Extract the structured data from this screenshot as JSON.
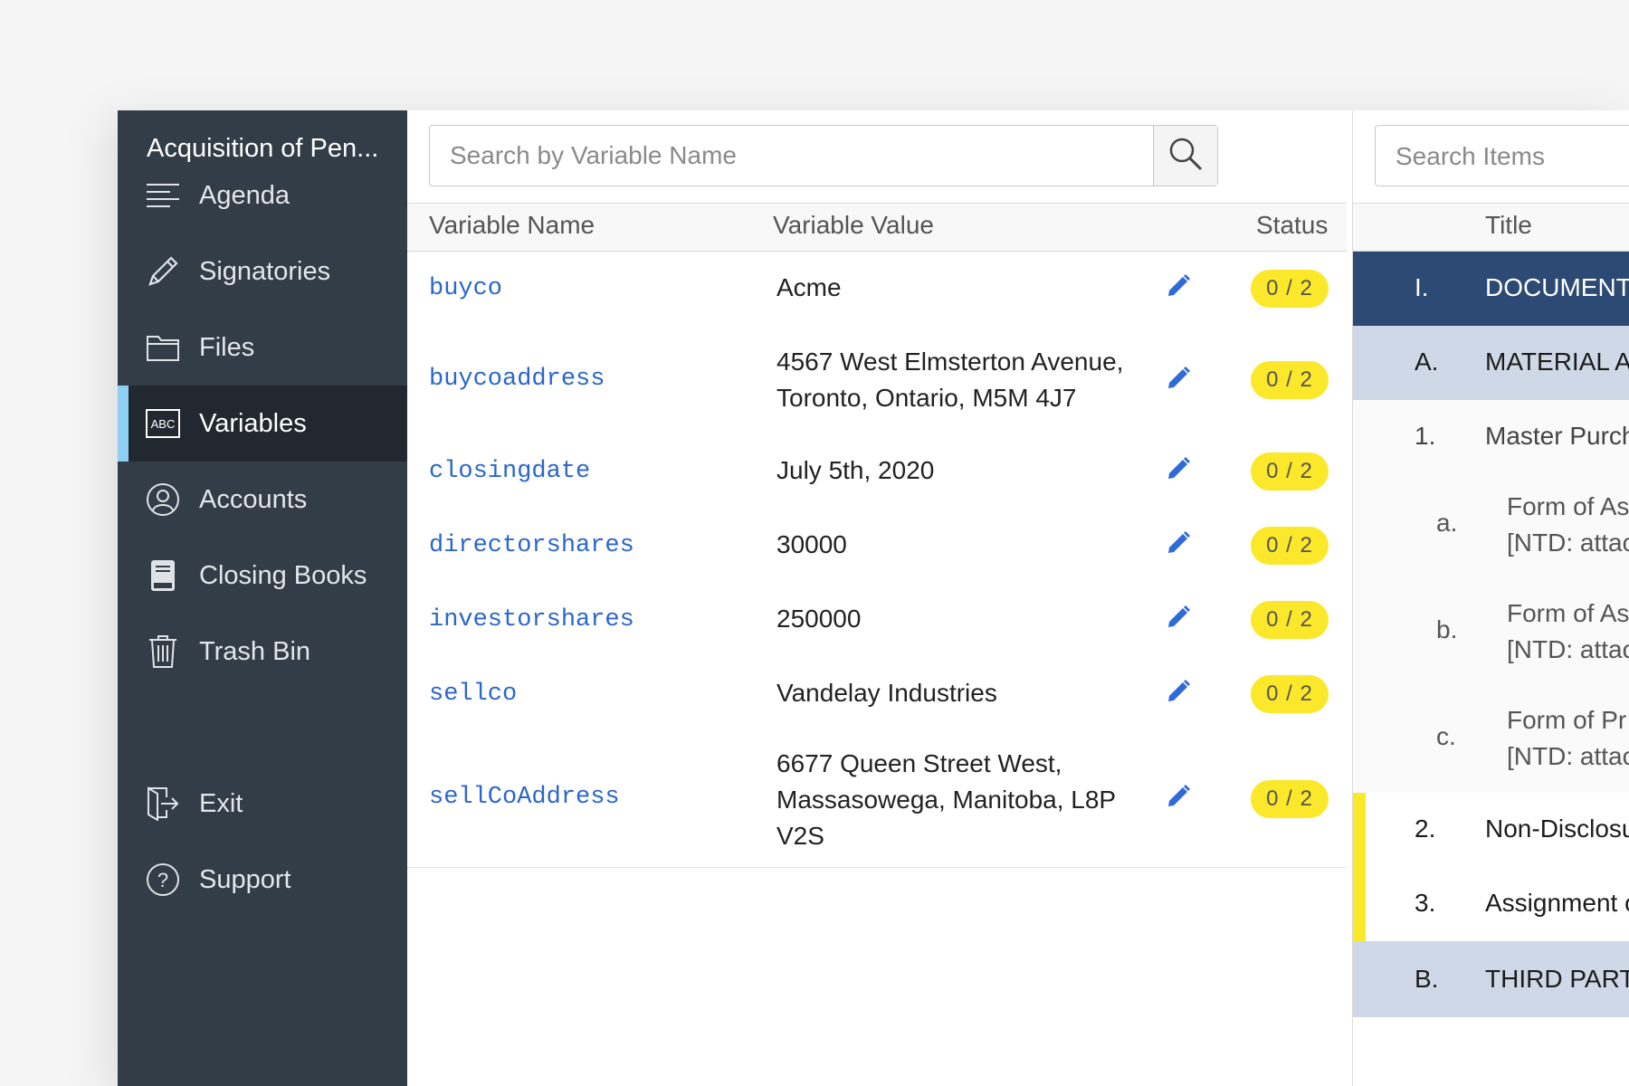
{
  "sidebar": {
    "title": "Acquisition of Pen...",
    "items": [
      {
        "label": "Agenda",
        "icon": "list-icon"
      },
      {
        "label": "Signatories",
        "icon": "pencil-icon"
      },
      {
        "label": "Files",
        "icon": "folder-icon"
      },
      {
        "label": "Variables",
        "icon": "abc-icon",
        "active": true
      },
      {
        "label": "Accounts",
        "icon": "user-icon"
      },
      {
        "label": "Closing Books",
        "icon": "book-icon"
      },
      {
        "label": "Trash Bin",
        "icon": "trash-icon"
      }
    ],
    "bottom_items": [
      {
        "label": "Exit",
        "icon": "exit-icon"
      },
      {
        "label": "Support",
        "icon": "help-icon"
      }
    ],
    "abc_icon_text": "ABC"
  },
  "variables": {
    "search": {
      "placeholder": "Search by Variable Name",
      "value": ""
    },
    "columns": {
      "name": "Variable Name",
      "value": "Variable Value",
      "status": "Status"
    },
    "rows": [
      {
        "name": "buyco",
        "value": "Acme",
        "status": "0 / 2"
      },
      {
        "name": "buycoaddress",
        "value": "4567 West Elmsterton Avenue, Toronto, Ontario, M5M 4J7",
        "status": "0 / 2"
      },
      {
        "name": "closingdate",
        "value": "July 5th, 2020",
        "status": "0 / 2"
      },
      {
        "name": "directorshares",
        "value": "30000",
        "status": "0 / 2"
      },
      {
        "name": "investorshares",
        "value": "250000",
        "status": "0 / 2"
      },
      {
        "name": "sellco",
        "value": "Vandelay Industries",
        "status": "0 / 2"
      },
      {
        "name": "sellCoAddress",
        "value": "6677 Queen Street West, Massasowega, Manitoba, L8P V2S",
        "status": "0 / 2"
      }
    ]
  },
  "items": {
    "search": {
      "placeholder": "Search Items",
      "value": ""
    },
    "column_title": "Title",
    "rows": [
      {
        "num": "I.",
        "text": "DOCUMENTS"
      },
      {
        "num": "A.",
        "text": "MATERIAL AC"
      },
      {
        "num": "1.",
        "text": "Master Purch"
      },
      {
        "num": "a.",
        "text": "Form of As",
        "text2": "[NTD: attac"
      },
      {
        "num": "b.",
        "text": "Form of As",
        "text2": "[NTD: attac"
      },
      {
        "num": "c.",
        "text": "Form of Pr",
        "text2": "[NTD: attac"
      },
      {
        "num": "2.",
        "text": "Non-Disclosu"
      },
      {
        "num": "3.",
        "text": "Assignment c"
      },
      {
        "num": "B.",
        "text": "THIRD PARTY"
      }
    ]
  },
  "colors": {
    "sidebar_bg": "#333d47",
    "sidebar_active_bg": "#212830",
    "sidebar_active_accent": "#8ed0f3",
    "link_blue": "#2b66cc",
    "status_yellow": "#fbe82a",
    "section_navy": "#2c4a73",
    "subsection_gray_blue": "#cfd8e6"
  }
}
